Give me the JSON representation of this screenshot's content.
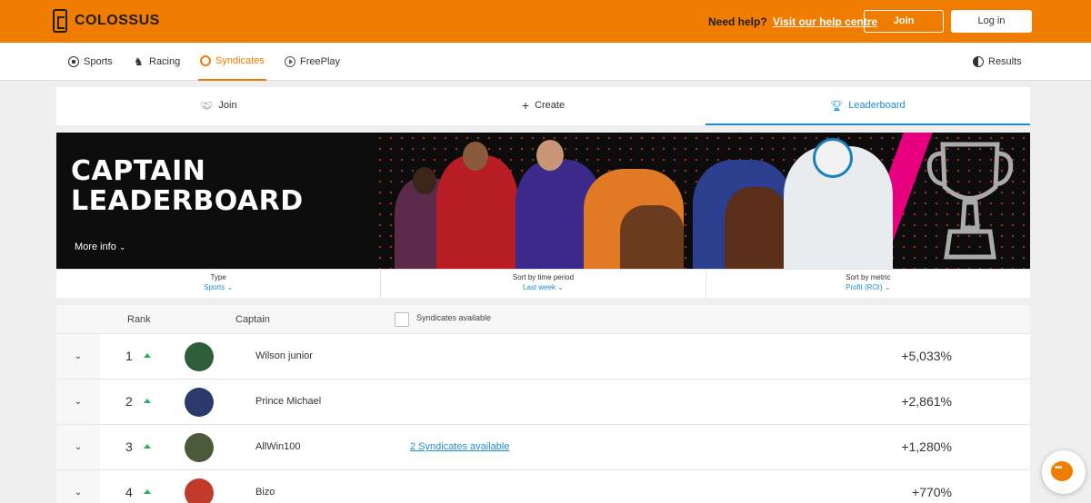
{
  "brand": {
    "name": "COLOSSUS"
  },
  "header": {
    "help_text": "Need help?",
    "help_link": "Visit our help centre",
    "join": "Join",
    "login": "Log in"
  },
  "nav": {
    "items": [
      {
        "label": "Sports",
        "icon": "football-icon"
      },
      {
        "label": "Racing",
        "icon": "horse-icon"
      },
      {
        "label": "Syndicates",
        "icon": "syndicates-icon",
        "active": true
      },
      {
        "label": "FreePlay",
        "icon": "play-icon"
      }
    ],
    "results": "Results"
  },
  "tabs": [
    {
      "label": "Join",
      "icon": "handshake-icon"
    },
    {
      "label": "Create",
      "icon": "plus-icon"
    },
    {
      "label": "Leaderboard",
      "icon": "trophy-icon",
      "active": true
    }
  ],
  "banner": {
    "title_line1": "CAPTAIN",
    "title_line2": "LEADERBOARD",
    "more_info": "More info"
  },
  "filters": [
    {
      "label": "Type",
      "value": "Sports"
    },
    {
      "label": "Sort by time period",
      "value": "Last week"
    },
    {
      "label": "Sort by metric",
      "value": "Profit (ROI)"
    }
  ],
  "table": {
    "headers": {
      "rank": "Rank",
      "captain": "Captain",
      "syndicates_available": "Syndicates available"
    },
    "rows": [
      {
        "rank": "1",
        "name": "Wilson junior",
        "syndicates": "",
        "value": "+5,033%",
        "avatar_color": "#2e5d3a"
      },
      {
        "rank": "2",
        "name": "Prince Michael",
        "syndicates": "",
        "value": "+2,861%",
        "avatar_color": "#2b3a6b"
      },
      {
        "rank": "3",
        "name": "AllWin100",
        "syndicates": "2 Syndicates available",
        "value": "+1,280%",
        "avatar_color": "#4a5a3a"
      },
      {
        "rank": "4",
        "name": "Bizo",
        "syndicates": "",
        "value": "+770%",
        "avatar_color": "#c0392b"
      }
    ]
  },
  "colors": {
    "brand_orange": "#f07d00",
    "accent_blue": "#1a8fd6",
    "up_green": "#27ae60"
  }
}
